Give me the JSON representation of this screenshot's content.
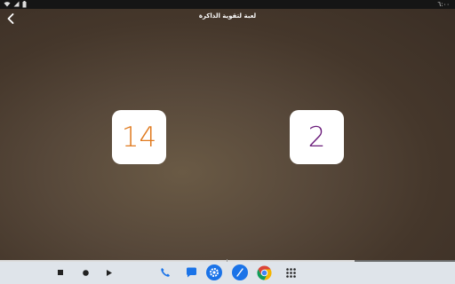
{
  "status_bar": {
    "time": "٦:٠٠",
    "icons": [
      "wifi-icon",
      "signal-icon",
      "battery-icon"
    ]
  },
  "app": {
    "title": "لعبة لتقوية الذاكرة",
    "back_icon": "chevron-left-icon",
    "cards": [
      {
        "value": "14",
        "color": "#e07a1f"
      },
      {
        "value": "2",
        "color": "#6a1b7a"
      }
    ],
    "progress": 0.78
  },
  "navigation": {
    "buttons": [
      "stop-icon",
      "home-icon",
      "play-icon"
    ]
  },
  "dock": {
    "apps": [
      "phone-icon",
      "messages-icon",
      "settings-icon",
      "pen-icon",
      "chrome-icon",
      "app-grid-icon"
    ]
  },
  "colors": {
    "background": "#4e4033",
    "card": "#ffffff",
    "navbar": "#dfe4ea"
  }
}
